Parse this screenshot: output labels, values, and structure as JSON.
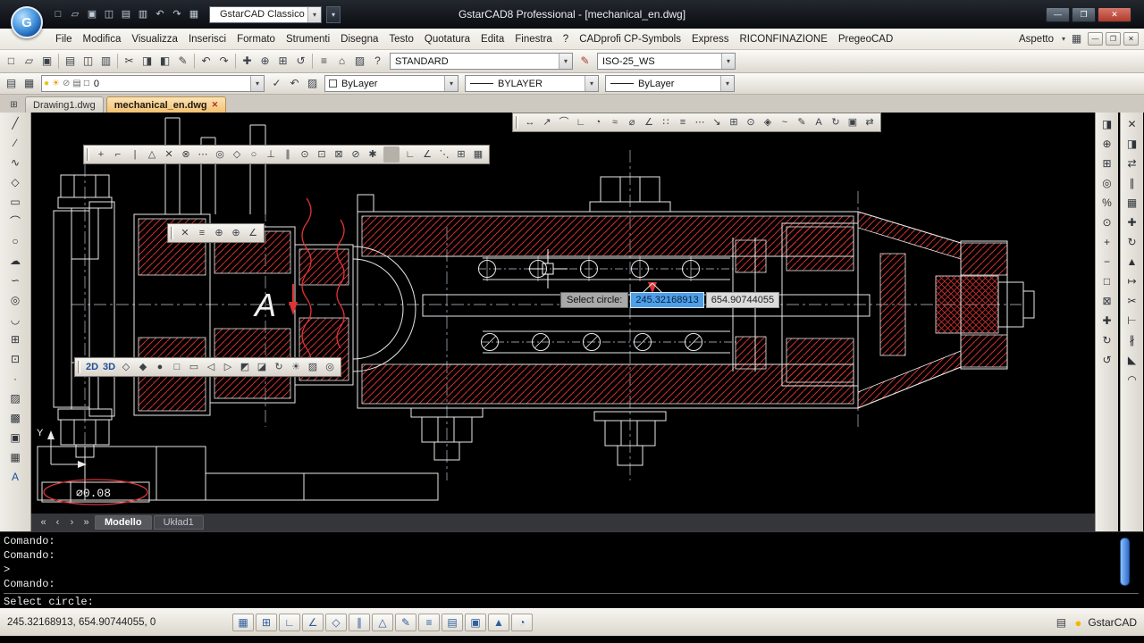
{
  "titlebar": {
    "logo_text": "G",
    "title": "GstarCAD8 Professional - [mechanical_en.dwg]",
    "workspace_combo": "GstarCAD Classico",
    "qat_icons": [
      {
        "name": "qat-new-icon",
        "glyph": "□"
      },
      {
        "name": "qat-open-icon",
        "glyph": "▱"
      },
      {
        "name": "qat-save-icon",
        "glyph": "▣"
      },
      {
        "name": "qat-saveas-icon",
        "glyph": "◫"
      },
      {
        "name": "qat-plot-icon",
        "glyph": "▤"
      },
      {
        "name": "qat-preview-icon",
        "glyph": "▥"
      },
      {
        "name": "qat-undo-icon",
        "glyph": "↶"
      },
      {
        "name": "qat-redo-icon",
        "glyph": "↷"
      },
      {
        "name": "qat-workspace-icon",
        "glyph": "▦"
      }
    ],
    "window_buttons": [
      {
        "name": "minimize-button",
        "glyph": "—"
      },
      {
        "name": "maximize-button",
        "glyph": "❐"
      },
      {
        "name": "close-button",
        "glyph": "✕",
        "cls": "close"
      }
    ]
  },
  "menubar": {
    "items": [
      {
        "name": "menu-file",
        "label": "File"
      },
      {
        "name": "menu-modifica",
        "label": "Modifica"
      },
      {
        "name": "menu-visualizza",
        "label": "Visualizza"
      },
      {
        "name": "menu-inserisci",
        "label": "Inserisci"
      },
      {
        "name": "menu-formato",
        "label": "Formato"
      },
      {
        "name": "menu-strumenti",
        "label": "Strumenti"
      },
      {
        "name": "menu-disegna",
        "label": "Disegna"
      },
      {
        "name": "menu-testo",
        "label": "Testo"
      },
      {
        "name": "menu-quotatura",
        "label": "Quotatura"
      },
      {
        "name": "menu-edita",
        "label": "Edita"
      },
      {
        "name": "menu-finestra",
        "label": "Finestra"
      },
      {
        "name": "menu-help",
        "label": "?"
      },
      {
        "name": "menu-cadprofi-cp-symbols",
        "label": "CADprofi CP-Symbols"
      },
      {
        "name": "menu-express",
        "label": "Express"
      },
      {
        "name": "menu-riconfinazione",
        "label": "RICONFINAZIONE"
      },
      {
        "name": "menu-pregeocad",
        "label": "PregeoCAD"
      }
    ],
    "aspetto_label": "Aspetto"
  },
  "toolbar1": {
    "icons": [
      {
        "name": "qnew-icon",
        "glyph": "□"
      },
      {
        "name": "open-icon",
        "glyph": "▱"
      },
      {
        "name": "save-icon",
        "glyph": "▣"
      },
      {
        "name": "sep1",
        "glyph": "",
        "cls": "sep"
      },
      {
        "name": "plot-icon",
        "glyph": "▤"
      },
      {
        "name": "plot-preview-icon",
        "glyph": "◫"
      },
      {
        "name": "publish-icon",
        "glyph": "▥"
      },
      {
        "name": "sep2",
        "glyph": "",
        "cls": "sep"
      },
      {
        "name": "cut-icon",
        "glyph": "✂"
      },
      {
        "name": "copy-icon",
        "glyph": "◨"
      },
      {
        "name": "paste-icon",
        "glyph": "◧"
      },
      {
        "name": "match-properties-icon",
        "glyph": "✎"
      },
      {
        "name": "sep3",
        "glyph": "",
        "cls": "sep"
      },
      {
        "name": "undo-icon",
        "glyph": "↶"
      },
      {
        "name": "redo-icon",
        "glyph": "↷"
      },
      {
        "name": "sep4",
        "glyph": "",
        "cls": "sep"
      },
      {
        "name": "pan-icon",
        "glyph": "✚"
      },
      {
        "name": "zoom-realtime-icon",
        "glyph": "⊕"
      },
      {
        "name": "zoom-window-icon",
        "glyph": "⊞"
      },
      {
        "name": "zoom-previous-icon",
        "glyph": "↺"
      },
      {
        "name": "sep5",
        "glyph": "",
        "cls": "sep"
      },
      {
        "name": "properties-icon",
        "glyph": "≡"
      },
      {
        "name": "designcenter-icon",
        "glyph": "⌂"
      },
      {
        "name": "tool-palettes-icon",
        "glyph": "▨"
      },
      {
        "name": "help-icon",
        "glyph": "?"
      }
    ],
    "style_combo": "STANDARD",
    "mid_icons": [
      {
        "name": "match-dimstyle-icon",
        "glyph": "✎",
        "cls": "red-ic"
      }
    ],
    "dimstyle_combo": "ISO-25_WS"
  },
  "toolbar2": {
    "left_icons": [
      {
        "name": "layer-properties-icon",
        "glyph": "▤"
      },
      {
        "name": "layer-manager-icon",
        "glyph": "▦"
      }
    ],
    "layer_combo_icons": [
      {
        "name": "layer-on-icon",
        "glyph": "●",
        "color": "#e8c400"
      },
      {
        "name": "layer-freeze-icon",
        "glyph": "☀",
        "color": "#e89a00"
      },
      {
        "name": "layer-lock-icon",
        "glyph": "⊘",
        "color": "#777777"
      },
      {
        "name": "layer-plot-icon",
        "glyph": "▤",
        "color": "#666666"
      },
      {
        "name": "layer-color-icon",
        "glyph": "□",
        "color": "#333333"
      }
    ],
    "layer_combo": "0",
    "mid_icons": [
      {
        "name": "make-object-layer-current-icon",
        "glyph": "✓"
      },
      {
        "name": "layer-previous-icon",
        "glyph": "↶"
      },
      {
        "name": "layer-states-icon",
        "glyph": "▨"
      }
    ],
    "color_combo": "ByLayer",
    "linetype_combo": "BYLAYER",
    "lineweight_combo": "ByLayer"
  },
  "doc_tabs": {
    "new_icon": [
      {
        "name": "new-drawing-icon",
        "glyph": "⊞"
      }
    ],
    "tabs": [
      {
        "label": "Drawing1.dwg"
      },
      {
        "label": "mechanical_en.dwg"
      }
    ],
    "close_glyph": "✕"
  },
  "left_toolbar": [
    {
      "name": "line-tool-icon",
      "glyph": "╱"
    },
    {
      "name": "construction-line-icon",
      "glyph": "∕"
    },
    {
      "name": "polyline-icon",
      "glyph": "∿"
    },
    {
      "name": "polygon-icon",
      "glyph": "◇"
    },
    {
      "name": "rectangle-icon",
      "glyph": "▭"
    },
    {
      "name": "arc-icon",
      "glyph": "⌒"
    },
    {
      "name": "circle-icon",
      "glyph": "○"
    },
    {
      "name": "revision-cloud-icon",
      "glyph": "☁"
    },
    {
      "name": "spline-icon",
      "glyph": "∽"
    },
    {
      "name": "ellipse-icon",
      "glyph": "◎"
    },
    {
      "name": "ellipse-arc-icon",
      "glyph": "◡"
    },
    {
      "name": "insert-block-icon",
      "glyph": "⊞"
    },
    {
      "name": "make-block-icon",
      "glyph": "⊡"
    },
    {
      "name": "point-icon",
      "glyph": "·"
    },
    {
      "name": "hatch-icon",
      "glyph": "▨"
    },
    {
      "name": "gradient-icon",
      "glyph": "▩"
    },
    {
      "name": "region-icon",
      "glyph": "▣"
    },
    {
      "name": "table-icon",
      "glyph": "▦"
    },
    {
      "name": "multiline-text-icon",
      "glyph": "A",
      "color": "#1c4f96"
    }
  ],
  "right_toolbar_inner": [
    {
      "name": "draw-order-icon",
      "glyph": "◨"
    },
    {
      "name": "zoom-realtime-icon",
      "glyph": "⊕"
    },
    {
      "name": "zoom-window-icon",
      "glyph": "⊞"
    },
    {
      "name": "zoom-dynamic-icon",
      "glyph": "◎"
    },
    {
      "name": "zoom-scale-icon",
      "glyph": "%"
    },
    {
      "name": "zoom-center-icon",
      "glyph": "⊙"
    },
    {
      "name": "zoom-in-icon",
      "glyph": "+"
    },
    {
      "name": "zoom-out-icon",
      "glyph": "−"
    },
    {
      "name": "zoom-all-icon",
      "glyph": "□"
    },
    {
      "name": "zoom-extents-icon",
      "glyph": "⊠"
    },
    {
      "name": "pan-icon",
      "glyph": "✚"
    },
    {
      "name": "orbit-icon",
      "glyph": "↻"
    },
    {
      "name": "redraw-icon",
      "glyph": "↺"
    }
  ],
  "right_toolbar_outer": [
    {
      "name": "erase-icon",
      "glyph": "✕"
    },
    {
      "name": "copy-object-icon",
      "glyph": "◨"
    },
    {
      "name": "mirror-icon",
      "glyph": "⇄"
    },
    {
      "name": "offset-icon",
      "glyph": "∥"
    },
    {
      "name": "array-icon",
      "glyph": "▦"
    },
    {
      "name": "move-icon",
      "glyph": "✚"
    },
    {
      "name": "rotate-icon",
      "glyph": "↻"
    },
    {
      "name": "scale-icon",
      "glyph": "▲"
    },
    {
      "name": "stretch-icon",
      "glyph": "↦"
    },
    {
      "name": "trim-icon",
      "glyph": "✂"
    },
    {
      "name": "extend-icon",
      "glyph": "⊢"
    },
    {
      "name": "break-icon",
      "glyph": "∦"
    },
    {
      "name": "chamfer-icon",
      "glyph": "◣"
    },
    {
      "name": "fillet-icon",
      "glyph": "◠"
    }
  ],
  "float_toolbars": {
    "dim": [
      {
        "name": "dim-linear-icon",
        "glyph": "↔"
      },
      {
        "name": "dim-aligned-icon",
        "glyph": "↗"
      },
      {
        "name": "dim-arc-length-icon",
        "glyph": "⌒"
      },
      {
        "name": "dim-ordinate-icon",
        "glyph": "∟"
      },
      {
        "name": "dim-radius-icon",
        "glyph": "◔"
      },
      {
        "name": "dim-jogged-icon",
        "glyph": "≈"
      },
      {
        "name": "dim-diameter-icon",
        "glyph": "⌀"
      },
      {
        "name": "dim-angular-icon",
        "glyph": "∠"
      },
      {
        "name": "quick-dim-icon",
        "glyph": "∷"
      },
      {
        "name": "dim-baseline-icon",
        "glyph": "≡"
      },
      {
        "name": "dim-continue-icon",
        "glyph": "⋯"
      },
      {
        "name": "quick-leader-icon",
        "glyph": "↘"
      },
      {
        "name": "tolerance-icon",
        "glyph": "⊞"
      },
      {
        "name": "center-mark-icon",
        "glyph": "⊙"
      },
      {
        "name": "dim-inspect-icon",
        "glyph": "◈"
      },
      {
        "name": "dim-jogline-icon",
        "glyph": "~"
      },
      {
        "name": "dim-edit-icon",
        "glyph": "✎"
      },
      {
        "name": "dim-text-edit-icon",
        "glyph": "A"
      },
      {
        "name": "dim-update-icon",
        "glyph": "↻"
      },
      {
        "name": "dim-style-icon",
        "glyph": "▣"
      },
      {
        "name": "dim-space-icon",
        "glyph": "⇄"
      }
    ],
    "osnap": [
      {
        "name": "temp-track-icon",
        "glyph": "+"
      },
      {
        "name": "snap-from-icon",
        "glyph": "⌐"
      },
      {
        "name": "snap-endpoint-icon",
        "glyph": "|"
      },
      {
        "name": "snap-midpoint-icon",
        "glyph": "△"
      },
      {
        "name": "snap-intersection-icon",
        "glyph": "✕"
      },
      {
        "name": "snap-apparent-icon",
        "glyph": "⊗"
      },
      {
        "name": "snap-extension-icon",
        "glyph": "⋯"
      },
      {
        "name": "snap-center-icon",
        "glyph": "◎"
      },
      {
        "name": "snap-quadrant-icon",
        "glyph": "◇"
      },
      {
        "name": "snap-tangent-icon",
        "glyph": "○"
      },
      {
        "name": "snap-perpendicular-icon",
        "glyph": "⊥"
      },
      {
        "name": "snap-parallel-icon",
        "glyph": "∥"
      },
      {
        "name": "snap-node-icon",
        "glyph": "⊙"
      },
      {
        "name": "snap-insert-icon",
        "glyph": "⊡"
      },
      {
        "name": "snap-nearest-icon",
        "glyph": "⊠"
      },
      {
        "name": "snap-none-icon",
        "glyph": "⊘"
      },
      {
        "name": "osnap-settings-icon",
        "glyph": "✱"
      },
      {
        "name": "sep-os",
        "glyph": "",
        "cls": "sep"
      },
      {
        "name": "ortho-icon",
        "glyph": "∟"
      },
      {
        "name": "polar-icon",
        "glyph": "∠"
      },
      {
        "name": "otrack-icon",
        "glyph": "⋱"
      },
      {
        "name": "grid-icon",
        "glyph": "⊞"
      },
      {
        "name": "snap-toggle-icon",
        "glyph": "▦"
      }
    ],
    "inquiry": [
      {
        "name": "osnap-off-icon",
        "glyph": "✕"
      },
      {
        "name": "list-icon",
        "glyph": "≡"
      },
      {
        "name": "id-point-icon",
        "glyph": "⊕"
      },
      {
        "name": "distance-icon",
        "glyph": "⊕"
      },
      {
        "name": "measure-angle-icon",
        "glyph": "∠"
      }
    ],
    "view": [
      {
        "name": "view-2d-icon",
        "glyph": "2D",
        "cls": "txt"
      },
      {
        "name": "view-3d-icon",
        "glyph": "3D",
        "cls": "txt"
      },
      {
        "name": "wireframe-icon",
        "glyph": "◇"
      },
      {
        "name": "hidden-icon",
        "glyph": "◆"
      },
      {
        "name": "realistic-icon",
        "glyph": "●"
      },
      {
        "name": "view-top-icon",
        "glyph": "□"
      },
      {
        "name": "view-front-icon",
        "glyph": "▭"
      },
      {
        "name": "view-left-icon",
        "glyph": "◁"
      },
      {
        "name": "view-right-icon",
        "glyph": "▷"
      },
      {
        "name": "view-swiso-icon",
        "glyph": "◩"
      },
      {
        "name": "view-seiso-icon",
        "glyph": "◪"
      },
      {
        "name": "free-orbit-icon",
        "glyph": "↻"
      },
      {
        "name": "sun-icon",
        "glyph": "☀"
      },
      {
        "name": "render-icon",
        "glyph": "▨"
      },
      {
        "name": "camera-icon",
        "glyph": "◎"
      }
    ]
  },
  "canvas": {
    "annotation_a": "A",
    "tolerance": "⌀0.08",
    "ucs_label": "Y"
  },
  "dyn_input": {
    "prompt": "Select circle:",
    "x_value": "245.32168913",
    "y_value": "654.90744055"
  },
  "layout_bar": {
    "nav_icons": [
      {
        "name": "layout-first-icon",
        "glyph": "«"
      },
      {
        "name": "layout-prev-icon",
        "glyph": "‹"
      },
      {
        "name": "layout-next-icon",
        "glyph": "›"
      },
      {
        "name": "layout-last-icon",
        "glyph": "»"
      }
    ],
    "tabs": [
      "Modello",
      "Układ1"
    ]
  },
  "command": {
    "lines": [
      "Comando:",
      "Comando:",
      ">",
      "Comando:"
    ],
    "prompt": "Select circle:"
  },
  "statusbar": {
    "coords": "245.32168913, 654.90744055, 0",
    "buttons": [
      {
        "name": "snap-toggle",
        "glyph": "▦"
      },
      {
        "name": "grid-toggle",
        "glyph": "⊞"
      },
      {
        "name": "ortho-toggle",
        "glyph": "∟"
      },
      {
        "name": "polar-toggle",
        "glyph": "∠"
      },
      {
        "name": "osnap-toggle",
        "glyph": "◇"
      },
      {
        "name": "otrack-toggle",
        "glyph": "∥"
      },
      {
        "name": "ducs-toggle",
        "glyph": "△"
      },
      {
        "name": "dyn-toggle",
        "glyph": "✎"
      },
      {
        "name": "lwt-toggle",
        "glyph": "≡"
      },
      {
        "name": "qp-toggle",
        "glyph": "▤"
      },
      {
        "name": "model-toggle",
        "glyph": "▣"
      },
      {
        "name": "annot-visibility-toggle",
        "glyph": "▲"
      },
      {
        "name": "annot-scale-toggle",
        "glyph": "◔"
      }
    ],
    "right_icons": [
      {
        "name": "plot-notify-icon",
        "glyph": "▤"
      }
    ],
    "bulb_icon": "●",
    "brand": "GstarCAD"
  }
}
